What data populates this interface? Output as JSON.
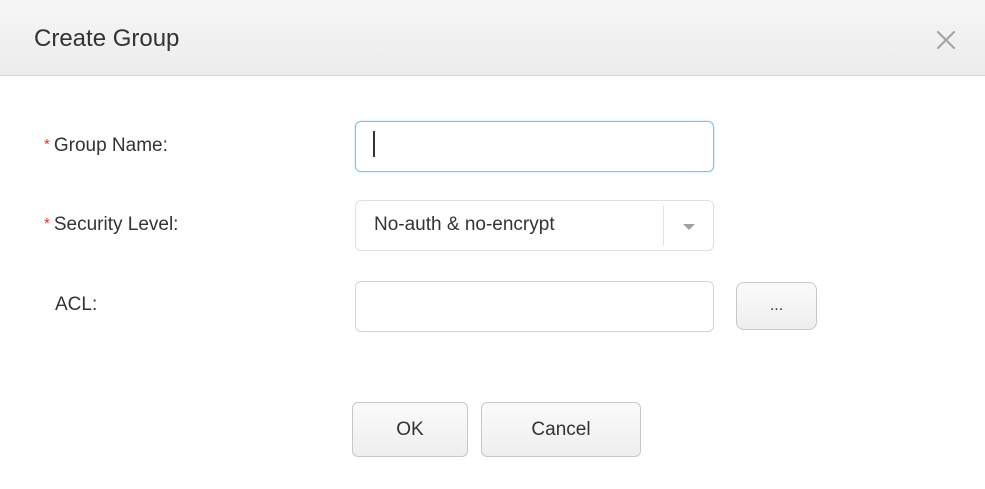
{
  "dialog": {
    "title": "Create Group",
    "close_icon": "close-icon"
  },
  "form": {
    "required_mark": "*",
    "group_name": {
      "label": "Group Name:",
      "value": ""
    },
    "security_level": {
      "label": "Security Level:",
      "selected": "No-auth & no-encrypt",
      "arrow_icon": "chevron-down-icon"
    },
    "acl": {
      "label": "ACL:",
      "value": "",
      "browse_label": "..."
    }
  },
  "actions": {
    "ok_label": "OK",
    "cancel_label": "Cancel"
  },
  "colors": {
    "required": "#e0322a",
    "focus_border": "#7ec3ef",
    "header_bg": "#efefef"
  }
}
